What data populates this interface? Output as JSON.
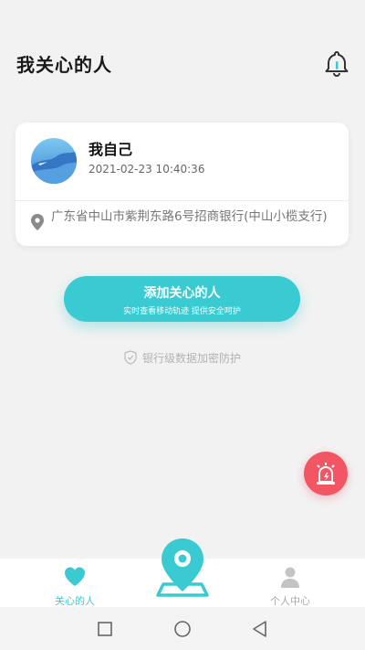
{
  "header": {
    "title": "我关心的人",
    "bell_icon": "bell-icon"
  },
  "card": {
    "name": "我自己",
    "time": "2021-02-23 10:40:36",
    "address": "广东省中山市紫荆东路6号招商银行(中山小榄支行)",
    "avatar_icon": "avatar"
  },
  "add_button": {
    "title": "添加关心的人",
    "subtitle": "实时查看移动轨迹 提供安全呵护"
  },
  "security": {
    "text": "银行级数据加密防护",
    "icon": "shield-icon"
  },
  "sos": {
    "icon": "alarm-icon"
  },
  "tabs": [
    {
      "label": "关心的人",
      "icon": "heart-icon",
      "active": true
    },
    {
      "label": "",
      "icon": "location-pin-icon",
      "active": false
    },
    {
      "label": "个人中心",
      "icon": "person-icon",
      "active": false
    }
  ],
  "colors": {
    "accent": "#3acbd2",
    "sos": "#f25564",
    "background": "#f2f2f2"
  }
}
